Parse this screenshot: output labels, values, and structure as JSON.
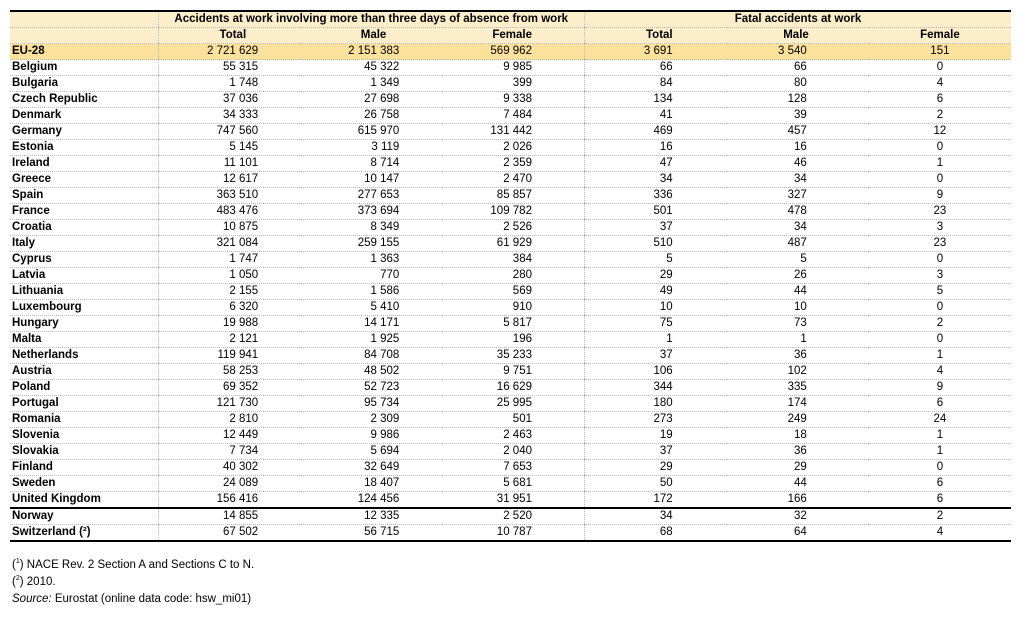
{
  "table": {
    "group_headers": [
      "Accidents at work involving more than three days of absence from work",
      "Fatal accidents at work"
    ],
    "sub_headers": [
      "Total",
      "Male",
      "Female",
      "Total",
      "Male",
      "Female"
    ],
    "aggregate_row": {
      "label": "EU-28",
      "values": [
        "2 721 629",
        "2 151 383",
        "569 962",
        "3 691",
        "3 540",
        "151"
      ]
    },
    "rows": [
      {
        "label": "Belgium",
        "values": [
          "55 315",
          "45 322",
          "9 985",
          "66",
          "66",
          "0"
        ]
      },
      {
        "label": "Bulgaria",
        "values": [
          "1 748",
          "1 349",
          "399",
          "84",
          "80",
          "4"
        ]
      },
      {
        "label": "Czech Republic",
        "values": [
          "37 036",
          "27 698",
          "9 338",
          "134",
          "128",
          "6"
        ]
      },
      {
        "label": "Denmark",
        "values": [
          "34 333",
          "26 758",
          "7 484",
          "41",
          "39",
          "2"
        ]
      },
      {
        "label": "Germany",
        "values": [
          "747 560",
          "615 970",
          "131 442",
          "469",
          "457",
          "12"
        ]
      },
      {
        "label": "Estonia",
        "values": [
          "5 145",
          "3 119",
          "2 026",
          "16",
          "16",
          "0"
        ]
      },
      {
        "label": "Ireland",
        "values": [
          "11 101",
          "8 714",
          "2 359",
          "47",
          "46",
          "1"
        ]
      },
      {
        "label": "Greece",
        "values": [
          "12 617",
          "10 147",
          "2 470",
          "34",
          "34",
          "0"
        ]
      },
      {
        "label": "Spain",
        "values": [
          "363 510",
          "277 653",
          "85 857",
          "336",
          "327",
          "9"
        ]
      },
      {
        "label": "France",
        "values": [
          "483 476",
          "373 694",
          "109 782",
          "501",
          "478",
          "23"
        ]
      },
      {
        "label": "Croatia",
        "values": [
          "10 875",
          "8 349",
          "2 526",
          "37",
          "34",
          "3"
        ]
      },
      {
        "label": "Italy",
        "values": [
          "321 084",
          "259 155",
          "61 929",
          "510",
          "487",
          "23"
        ]
      },
      {
        "label": "Cyprus",
        "values": [
          "1 747",
          "1 363",
          "384",
          "5",
          "5",
          "0"
        ]
      },
      {
        "label": "Latvia",
        "values": [
          "1 050",
          "770",
          "280",
          "29",
          "26",
          "3"
        ]
      },
      {
        "label": "Lithuania",
        "values": [
          "2 155",
          "1 586",
          "569",
          "49",
          "44",
          "5"
        ]
      },
      {
        "label": "Luxembourg",
        "values": [
          "6 320",
          "5 410",
          "910",
          "10",
          "10",
          "0"
        ]
      },
      {
        "label": "Hungary",
        "values": [
          "19 988",
          "14 171",
          "5 817",
          "75",
          "73",
          "2"
        ]
      },
      {
        "label": "Malta",
        "values": [
          "2 121",
          "1 925",
          "196",
          "1",
          "1",
          "0"
        ]
      },
      {
        "label": "Netherlands",
        "values": [
          "119 941",
          "84 708",
          "35 233",
          "37",
          "36",
          "1"
        ]
      },
      {
        "label": "Austria",
        "values": [
          "58 253",
          "48 502",
          "9 751",
          "106",
          "102",
          "4"
        ]
      },
      {
        "label": "Poland",
        "values": [
          "69 352",
          "52 723",
          "16 629",
          "344",
          "335",
          "9"
        ]
      },
      {
        "label": "Portugal",
        "values": [
          "121 730",
          "95 734",
          "25 995",
          "180",
          "174",
          "6"
        ]
      },
      {
        "label": "Romania",
        "values": [
          "2 810",
          "2 309",
          "501",
          "273",
          "249",
          "24"
        ]
      },
      {
        "label": "Slovenia",
        "values": [
          "12 449",
          "9 986",
          "2 463",
          "19",
          "18",
          "1"
        ]
      },
      {
        "label": "Slovakia",
        "values": [
          "7 734",
          "5 694",
          "2 040",
          "37",
          "36",
          "1"
        ]
      },
      {
        "label": "Finland",
        "values": [
          "40 302",
          "32 649",
          "7 653",
          "29",
          "29",
          "0"
        ]
      },
      {
        "label": "Sweden",
        "values": [
          "24 089",
          "18 407",
          "5 681",
          "50",
          "44",
          "6"
        ]
      },
      {
        "label": "United Kingdom",
        "values": [
          "156 416",
          "124 456",
          "31 951",
          "172",
          "166",
          "6"
        ]
      }
    ],
    "non_eu_rows": [
      {
        "label": "Norway",
        "values": [
          "14 855",
          "12 335",
          "2 520",
          "34",
          "32",
          "2"
        ]
      },
      {
        "label": "Switzerland (²)",
        "values": [
          "67 502",
          "56 715",
          "10 787",
          "68",
          "64",
          "4"
        ]
      }
    ]
  },
  "notes": {
    "note1_marker": "1",
    "note1_text": " NACE Rev. 2 Section A and Sections C to N.",
    "note2_marker": "2",
    "note2_text": " 2010.",
    "source_label": "Source:",
    "source_text": " Eurostat (online data code: hsw_mi01)"
  },
  "colors": {
    "header_bg": "#fdeecb",
    "aggregate_row_bg": "#fce19d"
  }
}
